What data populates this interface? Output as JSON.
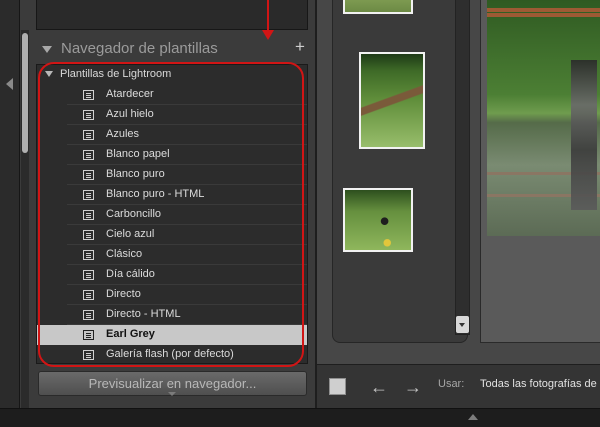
{
  "left_panel": {
    "navigator_title": "Navegador de plantillas",
    "add_button": "+",
    "folder_label": "Plantillas de Lightroom",
    "templates": [
      "Atardecer",
      "Azul hielo",
      "Azules",
      "Blanco papel",
      "Blanco puro",
      "Blanco puro - HTML",
      "Carboncillo",
      "Cielo azul",
      "Clásico",
      "Día cálido",
      "Directo",
      "Directo - HTML",
      "Earl Grey",
      "Galería flash (por defecto)"
    ],
    "selected_template": "Earl Grey",
    "preview_button": "Previsualizar en navegador..."
  },
  "toolbar": {
    "use_label": "Usar:",
    "use_value": "Todas las fotografías de",
    "back_icon": "←",
    "forward_icon": "→"
  },
  "colors": {
    "annotation_red": "#d11515",
    "panel_bg": "#3b3b3b",
    "selected_row_bg": "#c8c8c8"
  },
  "icons": {
    "template_icon": "web-template-icon",
    "collapse_icon": "triangle-down-icon",
    "add_icon": "plus-icon"
  }
}
